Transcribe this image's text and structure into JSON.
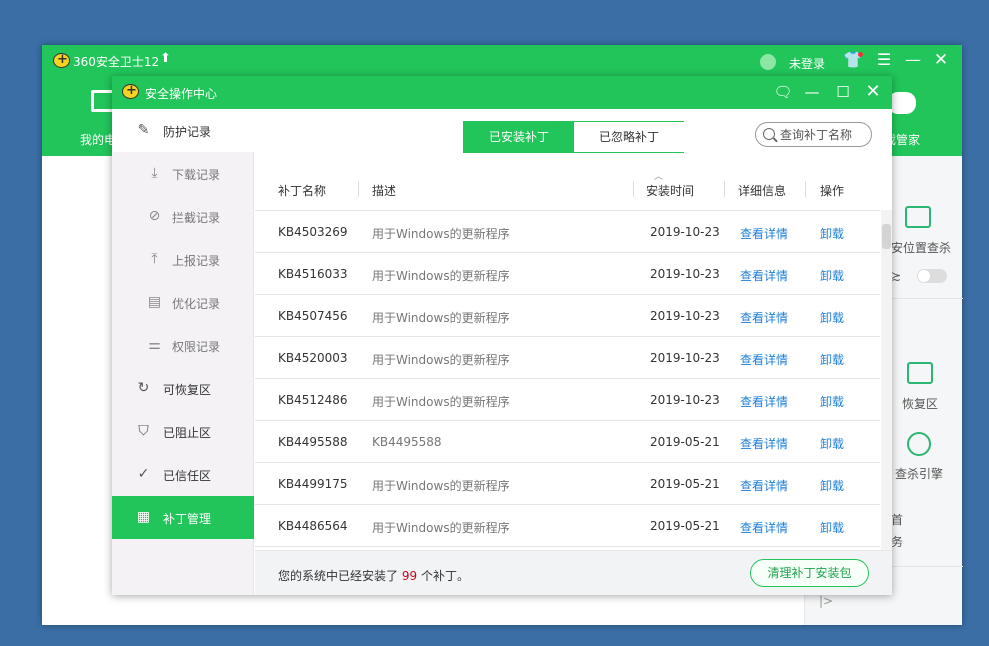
{
  "main_window": {
    "title": "360安全卫士12",
    "login_label": "未登录",
    "nav_my_label": "我的电",
    "nav_game_label": "戏管家",
    "right_panel": {
      "item1": "安位置查杀",
      "item1_tail": "≿",
      "item2": "恢复区",
      "item3": "查杀引擎",
      "item4": "首",
      "item5": "务",
      "item6": "|>"
    }
  },
  "dialog": {
    "title": "安全操作中心",
    "sidebar": [
      {
        "label": "防护记录",
        "icon": "edit-icon"
      },
      {
        "label": "下载记录",
        "icon": "download-icon"
      },
      {
        "label": "拦截记录",
        "icon": "block-icon"
      },
      {
        "label": "上报记录",
        "icon": "upload-icon"
      },
      {
        "label": "优化记录",
        "icon": "clipboard-icon"
      },
      {
        "label": "权限记录",
        "icon": "sliders-icon"
      },
      {
        "label": "可恢复区",
        "icon": "restore-icon"
      },
      {
        "label": "已阻止区",
        "icon": "shield-alert-icon"
      },
      {
        "label": "已信任区",
        "icon": "shield-check-icon"
      },
      {
        "label": "补丁管理",
        "icon": "grid-icon"
      }
    ],
    "tabs": {
      "installed": "已安装补丁",
      "ignored": "已忽略补丁"
    },
    "search": {
      "placeholder": "查询补丁名称"
    },
    "table": {
      "columns": [
        "补丁名称",
        "描述",
        "安装时间",
        "详细信息",
        "操作"
      ],
      "rows": [
        {
          "name": "KB4503269",
          "desc": "用于Windows的更新程序",
          "date": "2019-10-23",
          "detail": "查看详情",
          "op": "卸载"
        },
        {
          "name": "KB4516033",
          "desc": "用于Windows的更新程序",
          "date": "2019-10-23",
          "detail": "查看详情",
          "op": "卸载"
        },
        {
          "name": "KB4507456",
          "desc": "用于Windows的更新程序",
          "date": "2019-10-23",
          "detail": "查看详情",
          "op": "卸载"
        },
        {
          "name": "KB4520003",
          "desc": "用于Windows的更新程序",
          "date": "2019-10-23",
          "detail": "查看详情",
          "op": "卸载"
        },
        {
          "name": "KB4512486",
          "desc": "用于Windows的更新程序",
          "date": "2019-10-23",
          "detail": "查看详情",
          "op": "卸载"
        },
        {
          "name": "KB4495588",
          "desc": "KB4495588",
          "date": "2019-05-21",
          "detail": "查看详情",
          "op": "卸载"
        },
        {
          "name": "KB4499175",
          "desc": "用于Windows的更新程序",
          "date": "2019-05-21",
          "detail": "查看详情",
          "op": "卸载"
        },
        {
          "name": "KB4486564",
          "desc": "用于Windows的更新程序",
          "date": "2019-05-21",
          "detail": "查看详情",
          "op": "卸载"
        }
      ]
    },
    "footer": {
      "prefix": "您的系统中已经安装了",
      "count": "99",
      "suffix": "个补丁。",
      "clean_button": "清理补丁安装包"
    }
  },
  "colors": {
    "brand_green": "#21c55a",
    "link_blue": "#1f7fd6",
    "count_red": "#d0021b"
  }
}
